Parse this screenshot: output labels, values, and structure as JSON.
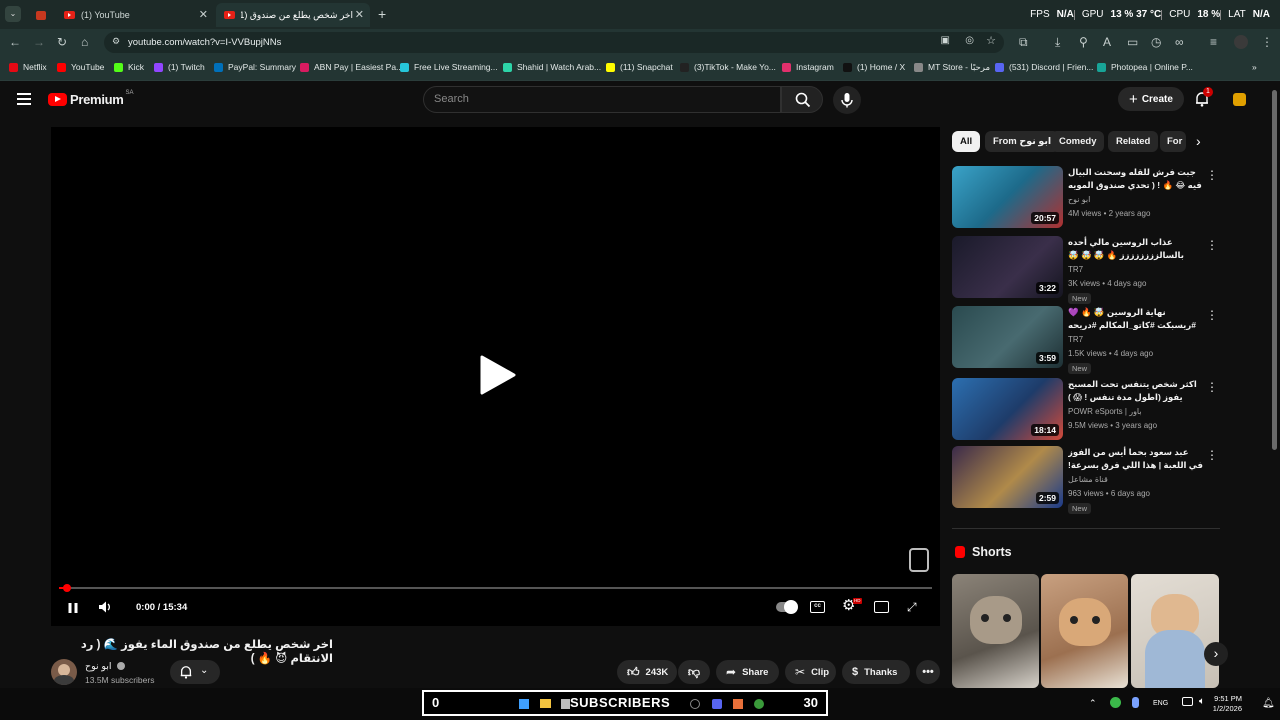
{
  "browser": {
    "tabs": [
      {
        "label": ""
      },
      {
        "label": "(1) YouTube"
      },
      {
        "label": "اخر شخص يطلع من صندوق (1) !!"
      }
    ],
    "url": "youtube.com/watch?v=I-VVBupjNNs",
    "hud": {
      "fps_label": "FPS",
      "fps_value": "N/A",
      "gpu_label": "GPU",
      "gpu_value": "13 %  37 °C",
      "cpu_label": "CPU",
      "cpu_value": "18 %",
      "lat_label": "LAT",
      "lat_value": "N/A"
    },
    "bookmarks": [
      {
        "label": "Netflix",
        "color": "#e50914"
      },
      {
        "label": "YouTube",
        "color": "#ff0000"
      },
      {
        "label": "Kick",
        "color": "#53fc18"
      },
      {
        "label": "(1) Twitch",
        "color": "#9146ff"
      },
      {
        "label": "PayPal: Summary",
        "color": "#0070ba"
      },
      {
        "label": "ABN Pay | Easiest Pa...",
        "color": "#d81b60"
      },
      {
        "label": "Free Live Streaming...",
        "color": "#26c6da"
      },
      {
        "label": "Shahid | Watch Arab...",
        "color": "#2dd4a8"
      },
      {
        "label": "(11) Snapchat",
        "color": "#fffc00"
      },
      {
        "label": "(3)TikTok - Make Yo...",
        "color": "#222222"
      },
      {
        "label": "Instagram",
        "color": "#e1306c"
      },
      {
        "label": "(1) Home / X",
        "color": "#111111"
      },
      {
        "label": "MT Store - مرحبًا",
        "color": "#888888"
      },
      {
        "label": "(531) Discord | Frien...",
        "color": "#5865f2"
      },
      {
        "label": "Photopea | Online P...",
        "color": "#18a497"
      }
    ]
  },
  "youtube": {
    "logo_text": "Premium",
    "logo_region": "SA",
    "search_placeholder": "Search",
    "create_label": "Create",
    "notifications_count": "1",
    "player": {
      "current_time": "0:00 / 15:34",
      "progress_fraction": 0.005
    },
    "video": {
      "title": "اخر شخص يطلع من صندوق الماء يفوز 🌊 ( رد الانتقام 😈 🔥 )",
      "channel": "ابو نوح",
      "subscribers": "13.5M subscribers",
      "likes": "243K",
      "share_label": "Share",
      "clip_label": "Clip",
      "thanks_label": "Thanks"
    },
    "chips": [
      {
        "label": "All"
      },
      {
        "label": "From ابو نوح"
      },
      {
        "label": "Comedy"
      },
      {
        "label": "Related"
      },
      {
        "label": "For"
      }
    ],
    "recommendations": [
      {
        "title": "جبت فرش للقله وسحنت البيال فيه 😂 🔥 ! ( تحدي صندوق المويه 🌊 ! )",
        "channel": "ابو نوح",
        "meta": "4M views • 2 years ago",
        "duration": "20:57",
        "badge": ""
      },
      {
        "title": "عذاب الروسين مالي أحده بالسالزززززززز 🔥 🤯 🤯 🤯 #ريسبكت #مالي ...",
        "channel": "TR7",
        "meta": "3K views • 4 days ago",
        "duration": "3:22",
        "badge": "New"
      },
      {
        "title": "نهاية الروسين 🤯 🔥 💜 #ريسبكت #كاتو_المكالم #دريحه #مالي ...",
        "channel": "TR7",
        "meta": "1.5K views • 4 days ago",
        "duration": "3:59",
        "badge": "New"
      },
      {
        "title": "اكثر شخص يتنفس تحت المسبح يفوز (اطول مدة تنفس ! 😱 )",
        "channel": "POWR eSports | باور",
        "meta": "9.5M views • 3 years ago",
        "duration": "18:14",
        "badge": ""
      },
      {
        "title": "عبد سعود بحما أيس من الفوز في اللعبة | هذا اللي فرق بسرعة! 😈",
        "channel": "قناة مشاعل",
        "meta": "963 views • 6 days ago",
        "duration": "2:59",
        "badge": "New"
      }
    ],
    "shorts_title": "Shorts"
  },
  "overlay": {
    "left_count": "0",
    "label": "SUBSCRIBERS",
    "right_count": "30"
  },
  "taskbar": {
    "lang": "ENG",
    "time": "9:51 PM",
    "date": "1/2/2026"
  },
  "colors": {
    "youtube_red": "#ff0000",
    "browser_chrome": "#233533",
    "page_bg": "#0f0f0f"
  }
}
